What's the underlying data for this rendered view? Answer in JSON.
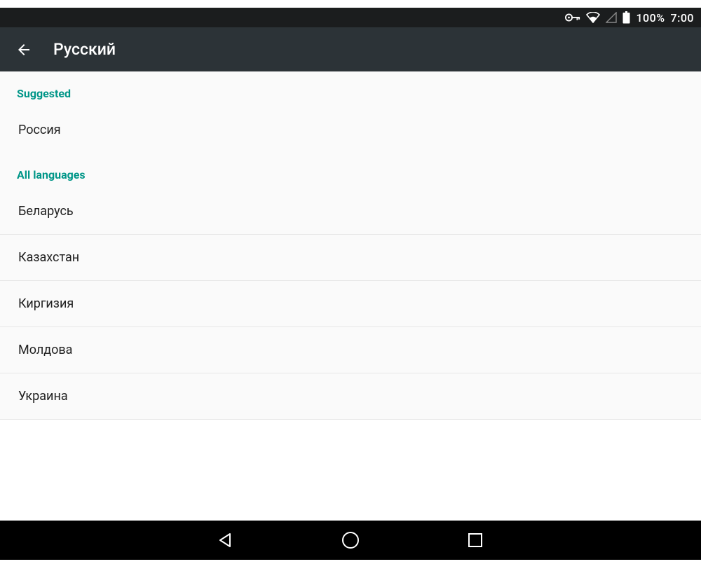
{
  "status_bar": {
    "battery_pct": "100%",
    "clock": "7:00"
  },
  "app_bar": {
    "title": "Русский"
  },
  "sections": {
    "suggested_label": "Suggested",
    "all_label": "All languages"
  },
  "suggested": [
    {
      "label": "Россия"
    }
  ],
  "all": [
    {
      "label": "Беларусь"
    },
    {
      "label": "Казахстан"
    },
    {
      "label": "Киргизия"
    },
    {
      "label": "Молдова"
    },
    {
      "label": "Украина"
    }
  ]
}
